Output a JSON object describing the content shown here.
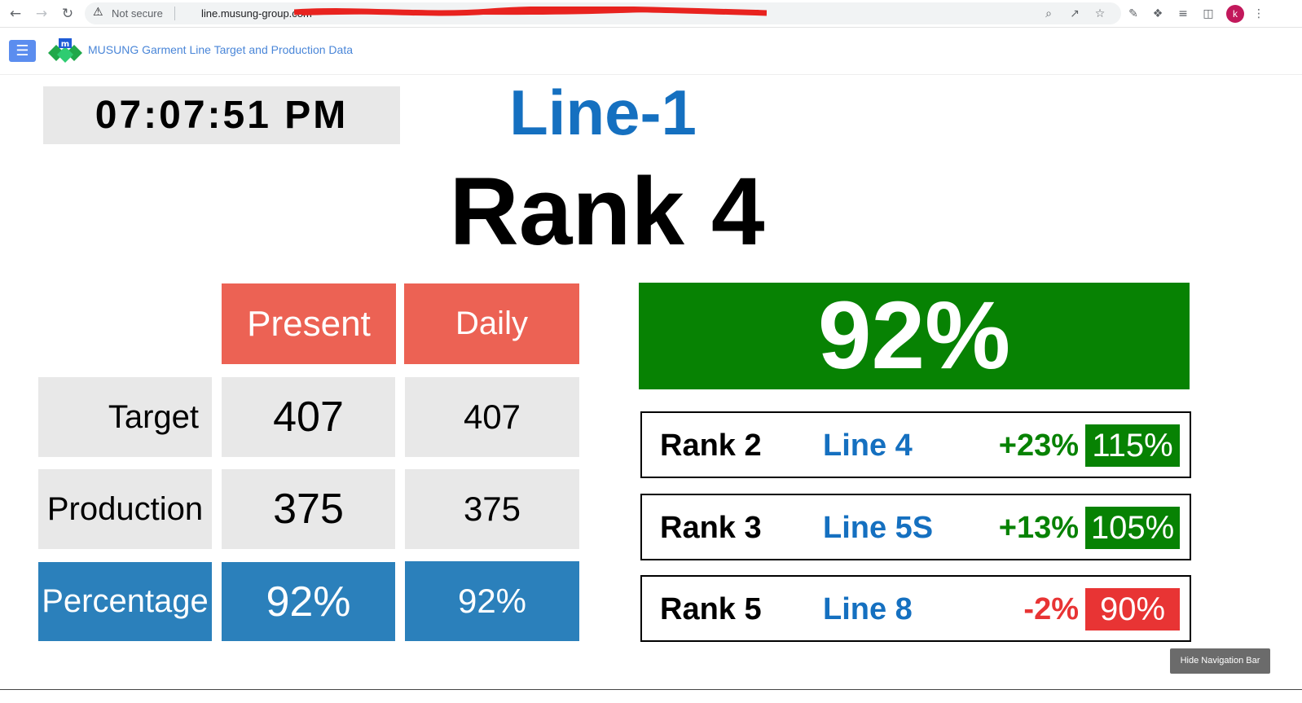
{
  "browser": {
    "security_label": "Not secure",
    "url": "line.musung-group.com"
  },
  "app": {
    "brand_title": "MUSUNG Garment Line Target and Production Data"
  },
  "dashboard": {
    "clock": "07:07:51 PM",
    "line_name": "Line-1",
    "rank_label": "Rank 4",
    "overall_percentage": "92%",
    "overall_color": "#078203",
    "table": {
      "col_present": "Present",
      "col_daily": "Daily",
      "rows": [
        {
          "label": "Target",
          "present": "407",
          "daily": "407"
        },
        {
          "label": "Production",
          "present": "375",
          "daily": "375"
        },
        {
          "label": "Percentage",
          "present": "92%",
          "daily": "92%"
        }
      ]
    },
    "rankings": [
      {
        "rank": "Rank 2",
        "line": "Line 4",
        "diff": "+23%",
        "pct": "115%",
        "diff_color": "#078203",
        "pct_color": "#078203"
      },
      {
        "rank": "Rank 3",
        "line": "Line 5S",
        "diff": "+13%",
        "pct": "105%",
        "diff_color": "#078203",
        "pct_color": "#078203"
      },
      {
        "rank": "Rank 5",
        "line": "Line 8",
        "diff": "-2%",
        "pct": "90%",
        "diff_color": "#e83434",
        "pct_color": "#e83434"
      }
    ]
  },
  "hide_nav_label": "Hide Navigation Bar"
}
